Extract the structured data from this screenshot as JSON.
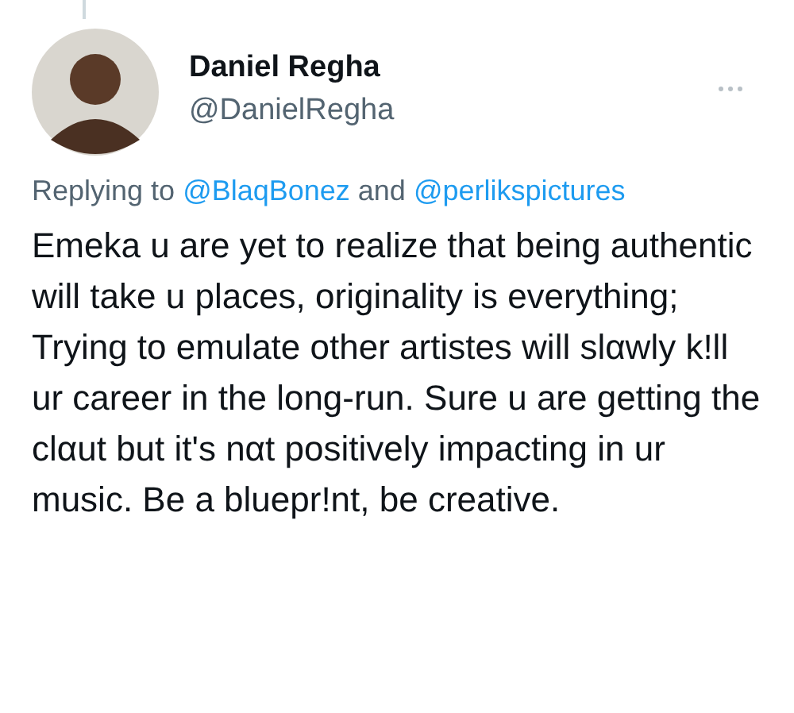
{
  "author": {
    "name": "Daniel Regha",
    "handle": "@DanielRegha"
  },
  "reply": {
    "prefix": "Replying to",
    "mentions": [
      "@BlaqBonez",
      "@perlikspictures"
    ],
    "joiner": "and"
  },
  "text": "Emeka u are yet to realize that being authentic will take u places, originality is everything;  Trying to emulate other artistes will slαwly k!ll ur career in the long-run. Sure u are getting the clαut but it's nαt positively impacting in ur music. Be a bluepr!nt, be creative."
}
